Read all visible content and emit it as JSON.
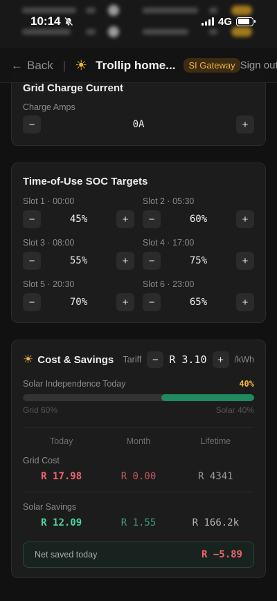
{
  "status_bar": {
    "time": "10:14",
    "network": "4G"
  },
  "header": {
    "back_label": "Back",
    "title": "Trollip home...",
    "badge": "SI Gateway",
    "signout_label": "Sign out"
  },
  "grid_charge": {
    "title": "Grid Charge Current",
    "field_label": "Charge Amps",
    "value": "0A",
    "minus": "−",
    "plus": "+"
  },
  "tou": {
    "title": "Time-of-Use SOC Targets",
    "slots": [
      {
        "label": "Slot 1 · 00:00",
        "value": "45%"
      },
      {
        "label": "Slot 2 · 05:30",
        "value": "60%"
      },
      {
        "label": "Slot 3 · 08:00",
        "value": "55%"
      },
      {
        "label": "Slot 4 · 17:00",
        "value": "75%"
      },
      {
        "label": "Slot 5 · 20:30",
        "value": "70%"
      },
      {
        "label": "Slot 6 · 23:00",
        "value": "65%"
      }
    ],
    "minus": "−",
    "plus": "+"
  },
  "cost": {
    "title": "Cost & Savings",
    "tariff_label": "Tariff",
    "tariff_value": "R 3.10",
    "tariff_unit": "/kWh",
    "independence_label": "Solar Independence Today",
    "independence_pct": "40%",
    "solar_fraction": 0.4,
    "grid_split": "Grid 60%",
    "solar_split": "Solar 40%",
    "columns": [
      "Today",
      "Month",
      "Lifetime"
    ],
    "grid_cost_label": "Grid Cost",
    "grid_cost": [
      "R 17.98",
      "R 0.00",
      "R 4341"
    ],
    "savings_label": "Solar Savings",
    "savings": [
      "R 12.09",
      "R 1.55",
      "R 166.2k"
    ],
    "net_label": "Net saved today",
    "net_value": "R −5.89"
  },
  "colors": {
    "accent_amber": "#f2b53a",
    "progress_green": "#1f8a5e",
    "cost_red": "#f0636b",
    "savings_green": "#4fd39a"
  }
}
